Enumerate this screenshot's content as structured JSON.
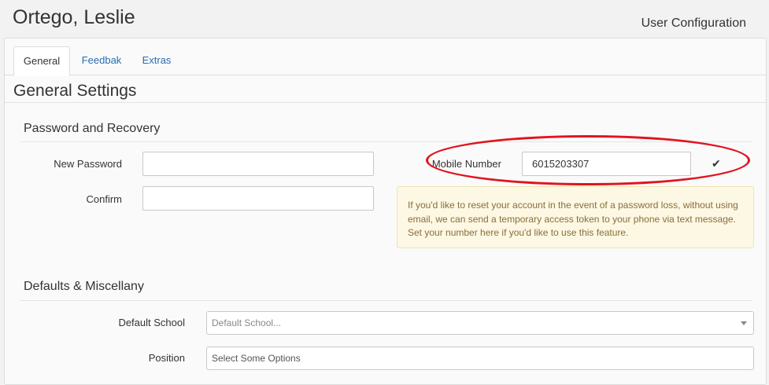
{
  "header": {
    "user_name": "Ortego, Leslie",
    "page_subtitle": "User Configuration"
  },
  "tabs": [
    {
      "label": "General",
      "active": true
    },
    {
      "label": "Feedbak",
      "active": false
    },
    {
      "label": "Extras",
      "active": false
    }
  ],
  "settings_title": "General Settings",
  "password_section": {
    "title": "Password and Recovery",
    "new_password_label": "New Password",
    "new_password_value": "",
    "confirm_label": "Confirm",
    "confirm_value": "",
    "mobile_label": "Mobile Number",
    "mobile_value": "6015203307",
    "check_icon": "checkmark-icon",
    "info_text": "If you'd like to reset your account in the event of a password loss, without using email, we can send a temporary access token to your phone via text message. Set your number here if you'd like to use this feature."
  },
  "defaults_section": {
    "title": "Defaults & Miscellany",
    "default_school_label": "Default School",
    "default_school_placeholder": "Default School...",
    "position_label": "Position",
    "position_placeholder": "Select Some Options"
  },
  "colors": {
    "link": "#2a6db0",
    "highlight_oval": "#e0141e",
    "info_bg": "#fdf8e3",
    "info_text": "#8a6d3b"
  }
}
